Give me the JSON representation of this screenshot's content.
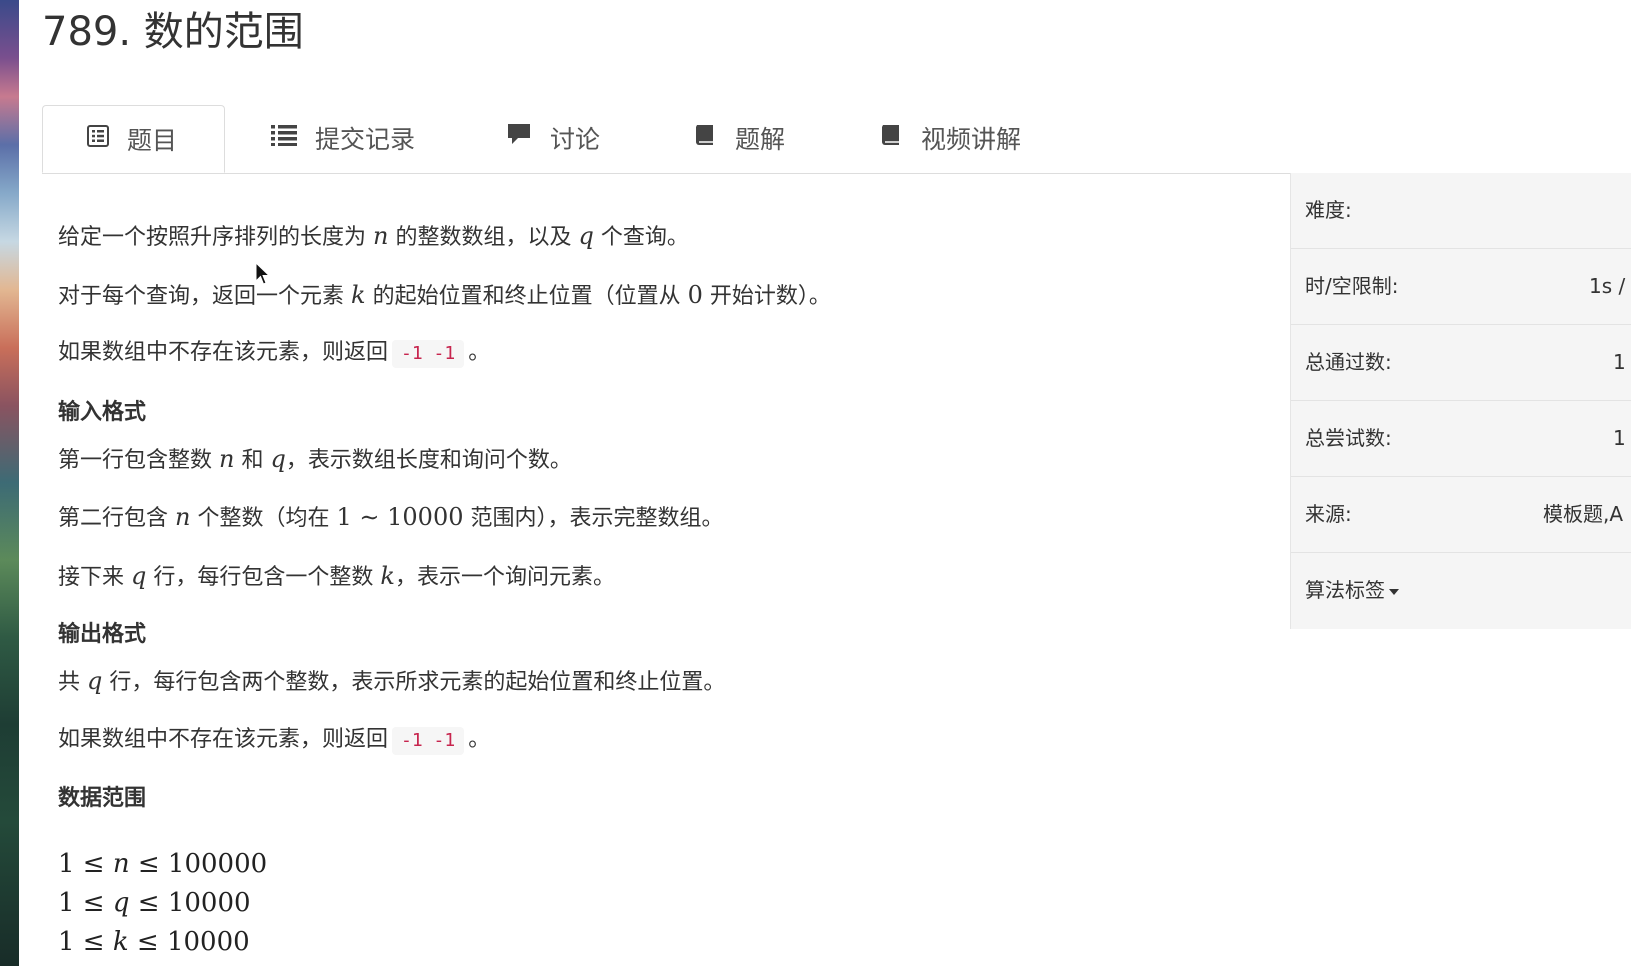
{
  "problem": {
    "title": "789. 数的范围"
  },
  "tabs": [
    {
      "label": "题目",
      "icon": "list-alt-icon"
    },
    {
      "label": "提交记录",
      "icon": "list-icon"
    },
    {
      "label": "讨论",
      "icon": "comment-icon"
    },
    {
      "label": "题解",
      "icon": "book-icon"
    },
    {
      "label": "视频讲解",
      "icon": "book-icon"
    }
  ],
  "content": {
    "p1": {
      "a": "给定一个按照升序排列的长度为",
      "n": "n",
      "b": "的整数数组，以及",
      "q": "q",
      "c": "个查询。"
    },
    "p2": {
      "a": "对于每个查询，返回一个元素",
      "k": "k",
      "b": "的起始位置和终止位置（位置从",
      "zero": "0",
      "c": "开始计数）。"
    },
    "p3": {
      "a": "如果数组中不存在该元素，则返回",
      "code": "-1 -1",
      "b": "。"
    },
    "input_heading": "输入格式",
    "p4": {
      "a": "第一行包含整数",
      "n": "n",
      "b": "和",
      "q": "q",
      "c": "，表示数组长度和询问个数。"
    },
    "p5": {
      "a": "第二行包含",
      "n": "n",
      "b": "个整数（均在",
      "range": "1 ∼ 10000",
      "c": "范围内），表示完整数组。"
    },
    "p6": {
      "a": "接下来",
      "q": "q",
      "b": "行，每行包含一个整数",
      "k": "k",
      "c": "，表示一个询问元素。"
    },
    "output_heading": "输出格式",
    "p7": {
      "a": "共",
      "q": "q",
      "b": "行，每行包含两个整数，表示所求元素的起始位置和终止位置。"
    },
    "p8": {
      "a": "如果数组中不存在该元素，则返回",
      "code": "-1 -1",
      "b": "。"
    },
    "range_heading": "数据范围",
    "ranges": [
      {
        "lo": "1 ≤ ",
        "var": "n",
        "hi": " ≤ 100000"
      },
      {
        "lo": "1 ≤ ",
        "var": "q",
        "hi": " ≤ 10000"
      },
      {
        "lo": "1 ≤ ",
        "var": "k",
        "hi": " ≤ 10000"
      }
    ]
  },
  "info": {
    "difficulty_label": "难度:",
    "limit_label": "时/空限制:",
    "limit_value": "1s /",
    "passed_label": "总通过数:",
    "passed_value": "1",
    "tried_label": "总尝试数:",
    "tried_value": "1",
    "source_label": "来源:",
    "source_value": "模板题,A",
    "tags_label": "算法标签"
  }
}
